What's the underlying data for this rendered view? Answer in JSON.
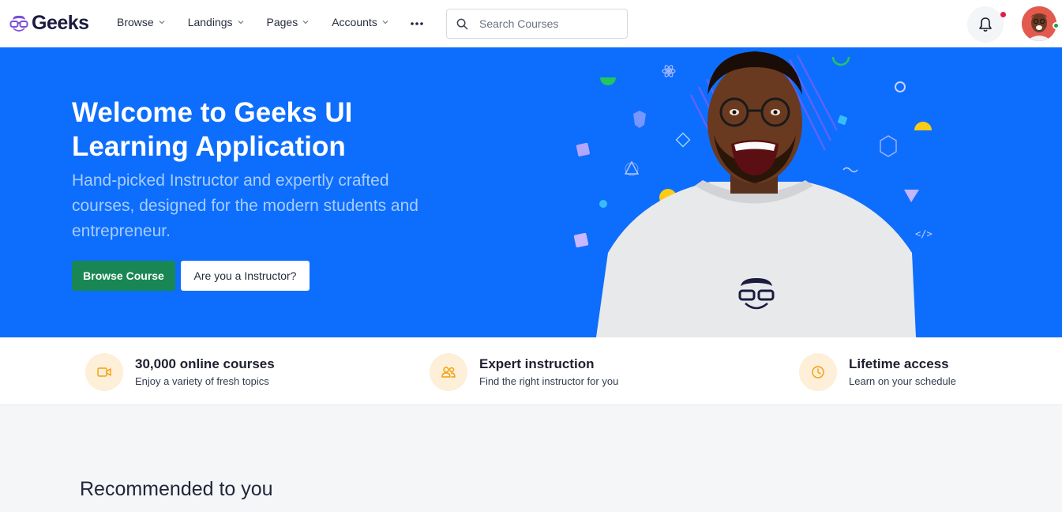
{
  "brand": {
    "name": "Geeks"
  },
  "nav": {
    "items": [
      {
        "label": "Browse"
      },
      {
        "label": "Landings"
      },
      {
        "label": "Pages"
      },
      {
        "label": "Accounts"
      }
    ]
  },
  "search": {
    "placeholder": "Search Courses"
  },
  "hero": {
    "title": "Welcome to Geeks UI Learning Application",
    "subtitle": "Hand-picked Instructor and expertly crafted courses, designed for the modern students and entrepreneur.",
    "primary_button": "Browse Course",
    "secondary_button": "Are you a Instructor?"
  },
  "features": [
    {
      "title": "30,000 online courses",
      "desc": "Enjoy a variety of fresh topics",
      "icon": "video-icon"
    },
    {
      "title": "Expert instruction",
      "desc": "Find the right instructor for you",
      "icon": "users-icon"
    },
    {
      "title": "Lifetime access",
      "desc": "Learn on your schedule",
      "icon": "clock-icon"
    }
  ],
  "recommended": {
    "title": "Recommended to you"
  },
  "colors": {
    "primary": "#0d6efd",
    "success": "#198754",
    "feature_icon_bg": "#fdefd8",
    "feature_icon": "#f59e0b"
  }
}
